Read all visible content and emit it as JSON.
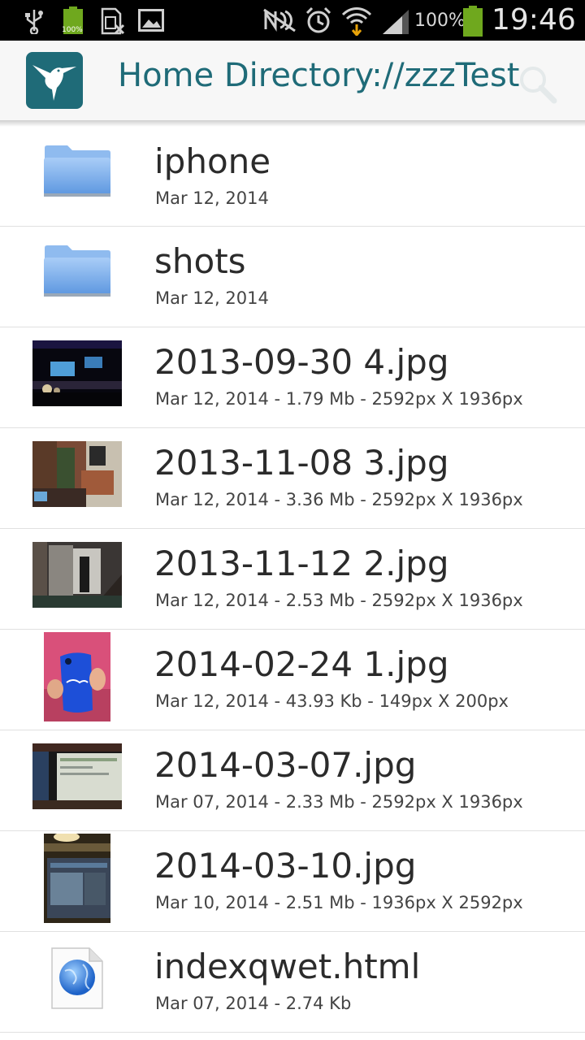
{
  "status_bar": {
    "battery_percent": "100%",
    "time": "19:46",
    "small_battery_label": "100%",
    "icons": [
      "usb-icon",
      "battery-icon",
      "sim-blocked-icon",
      "image-icon",
      "nfc-muted-icon",
      "alarm-icon",
      "wifi-icon",
      "signal-icon",
      "battery-icon"
    ]
  },
  "action_bar": {
    "app_icon": "hummingbird-logo",
    "title": "Home Directory://zzzTest",
    "search_icon": "search-icon"
  },
  "colors": {
    "accent": "#1f6b78",
    "folder": "#7fb2ee"
  },
  "files": [
    {
      "type": "folder",
      "name": "iphone",
      "meta": "Mar 12, 2014",
      "icon": "folder-icon"
    },
    {
      "type": "folder",
      "name": "shots",
      "meta": "Mar 12, 2014",
      "icon": "folder-icon"
    },
    {
      "type": "image",
      "name": "2013-09-30 4.jpg",
      "meta": "Mar 12, 2014 - 1.79 Mb - 2592px X 1936px",
      "icon": "image-thumbnail"
    },
    {
      "type": "image",
      "name": "2013-11-08 3.jpg",
      "meta": "Mar 12, 2014 - 3.36 Mb - 2592px X 1936px",
      "icon": "image-thumbnail"
    },
    {
      "type": "image",
      "name": "2013-11-12 2.jpg",
      "meta": "Mar 12, 2014 - 2.53 Mb - 2592px X 1936px",
      "icon": "image-thumbnail"
    },
    {
      "type": "image",
      "name": "2014-02-24 1.jpg",
      "meta": "Mar 12, 2014 - 43.93 Kb - 149px X 200px",
      "icon": "image-thumbnail"
    },
    {
      "type": "image",
      "name": "2014-03-07.jpg",
      "meta": "Mar 07, 2014 - 2.33 Mb - 2592px X 1936px",
      "icon": "image-thumbnail"
    },
    {
      "type": "image",
      "name": "2014-03-10.jpg",
      "meta": "Mar 10, 2014 - 2.51 Mb - 1936px X 2592px",
      "icon": "image-thumbnail"
    },
    {
      "type": "html",
      "name": "indexqwet.html",
      "meta": "Mar 07, 2014 - 2.74 Kb",
      "icon": "html-file-icon"
    }
  ]
}
